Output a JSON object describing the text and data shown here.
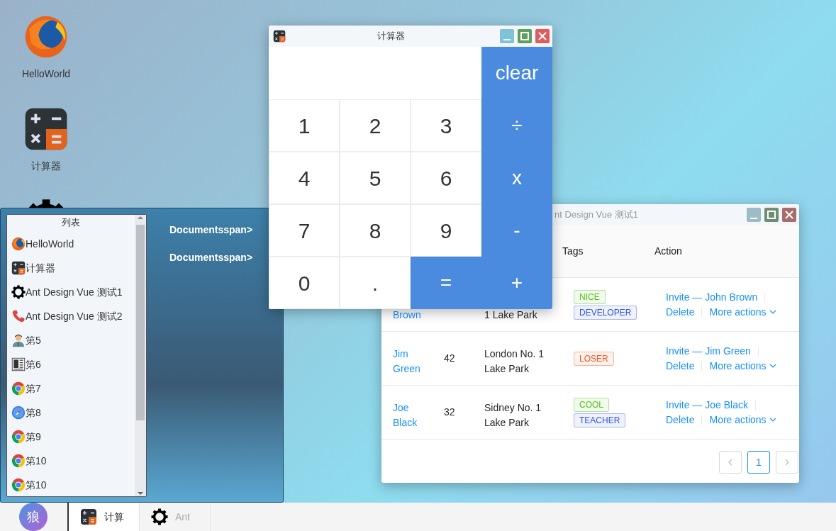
{
  "desktop_icons": [
    {
      "label": "HelloWorld",
      "kind": "globe"
    },
    {
      "label": "计算器",
      "kind": "calculator"
    },
    {
      "kind": "gear"
    }
  ],
  "calculator_window": {
    "title": "计算器",
    "active": true,
    "clear_key": "clear",
    "keys": [
      {
        "label": "1",
        "kind": "digit"
      },
      {
        "label": "2",
        "kind": "digit"
      },
      {
        "label": "3",
        "kind": "digit"
      },
      {
        "label": "÷",
        "kind": "operator"
      },
      {
        "label": "4",
        "kind": "digit"
      },
      {
        "label": "5",
        "kind": "digit"
      },
      {
        "label": "6",
        "kind": "digit"
      },
      {
        "label": "x",
        "kind": "operator"
      },
      {
        "label": "7",
        "kind": "digit"
      },
      {
        "label": "8",
        "kind": "digit"
      },
      {
        "label": "9",
        "kind": "digit"
      },
      {
        "label": "-",
        "kind": "operator"
      },
      {
        "label": "0",
        "kind": "digit"
      },
      {
        "label": ".",
        "kind": "digit"
      },
      {
        "label": "=",
        "kind": "operator"
      },
      {
        "label": "+",
        "kind": "operator"
      }
    ]
  },
  "table_window": {
    "title": "nt Design Vue 测试1",
    "active": false,
    "columns": [
      "Tags",
      "Action"
    ],
    "rows": [
      {
        "name": "Brown",
        "address": "1 Lake Park",
        "tags": [
          {
            "label": "NICE",
            "color": "#52c41a"
          },
          {
            "label": "DEVELOPER",
            "color": "#2f54eb"
          }
        ],
        "invite": "Invite — John Brown",
        "delete": "Delete",
        "more": "More actions"
      },
      {
        "name": "Jim Green",
        "age": "42",
        "address": "London No. 1 Lake Park",
        "tags": [
          {
            "label": "LOSER",
            "color": "#fa541c"
          }
        ],
        "invite": "Invite — Jim Green",
        "delete": "Delete",
        "more": "More actions"
      },
      {
        "name": "Joe Black",
        "age": "32",
        "address": "Sidney No. 1 Lake Park",
        "tags": [
          {
            "label": "COOL",
            "color": "#52c41a"
          },
          {
            "label": "TEACHER",
            "color": "#2f54eb"
          }
        ],
        "invite": "Invite — Joe Black",
        "delete": "Delete",
        "more": "More actions"
      }
    ],
    "pages": [
      {
        "label": "1",
        "selected": true
      }
    ]
  },
  "start_menu": {
    "list_title": "列表",
    "items": [
      {
        "label": "HelloWorld",
        "kind": "globe"
      },
      {
        "label": "计算器",
        "kind": "calculator"
      },
      {
        "label": "Ant Design Vue 测试1",
        "kind": "gear"
      },
      {
        "label": "Ant Design Vue 测试2",
        "kind": "phone"
      },
      {
        "label": "第5",
        "kind": "person"
      },
      {
        "label": "第6",
        "kind": "ledger"
      },
      {
        "label": "第7",
        "kind": "ring"
      },
      {
        "label": "第8",
        "kind": "compass"
      },
      {
        "label": "第9",
        "kind": "ring"
      },
      {
        "label": "第10",
        "kind": "ring"
      },
      {
        "label": "第10",
        "kind": "ring"
      }
    ],
    "links": [
      "Documentsspan>",
      "Documentsspan>"
    ]
  },
  "taskbar": {
    "avatar": "狼",
    "tasks": [
      {
        "label": "计算",
        "kind": "calculator",
        "selected": true
      },
      {
        "label": "Ant",
        "kind": "gear",
        "selected": false
      }
    ]
  }
}
